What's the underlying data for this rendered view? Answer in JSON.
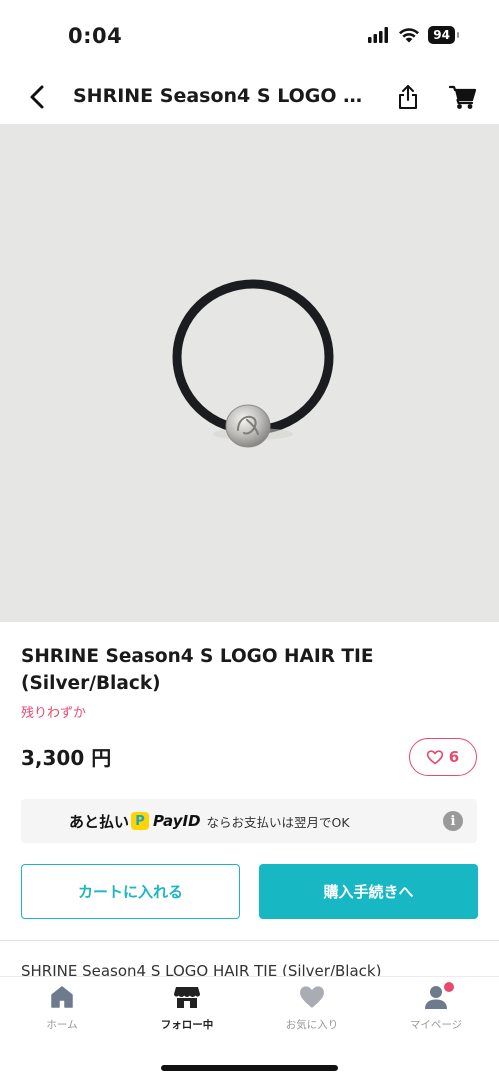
{
  "status_bar": {
    "time": "0:04",
    "battery": "94"
  },
  "nav": {
    "title": "SHRINE Season4 S LOGO H...",
    "back_icon": "chevron-left-icon",
    "share_icon": "share-icon",
    "cart_icon": "cart-icon"
  },
  "product": {
    "title": "SHRINE Season4 S LOGO HAIR TIE (Silver/Black)",
    "stock_status": "残りわずか",
    "price": "3,300 円",
    "like_count": "6",
    "description_preview": "SHRINE Season4 S LOGO HAIR TIE (Silver/Black)"
  },
  "payid_banner": {
    "prefix": "あと払い",
    "brand": "PayID",
    "suffix": "ならお支払いは翌月でOK",
    "info_icon": "info-icon"
  },
  "actions": {
    "add_to_cart": "カートに入れる",
    "checkout": "購入手続きへ"
  },
  "tab_bar": {
    "tabs": [
      {
        "label": "ホーム",
        "icon": "home-icon",
        "active": false
      },
      {
        "label": "フォロー中",
        "icon": "shop-icon",
        "active": true
      },
      {
        "label": "お気に入り",
        "icon": "heart-icon",
        "active": false
      },
      {
        "label": "マイページ",
        "icon": "person-icon",
        "active": false
      }
    ]
  },
  "colors": {
    "accent": "#17b7c3",
    "like_pink": "#e84a6e",
    "image_bg": "#e6e6e4"
  }
}
